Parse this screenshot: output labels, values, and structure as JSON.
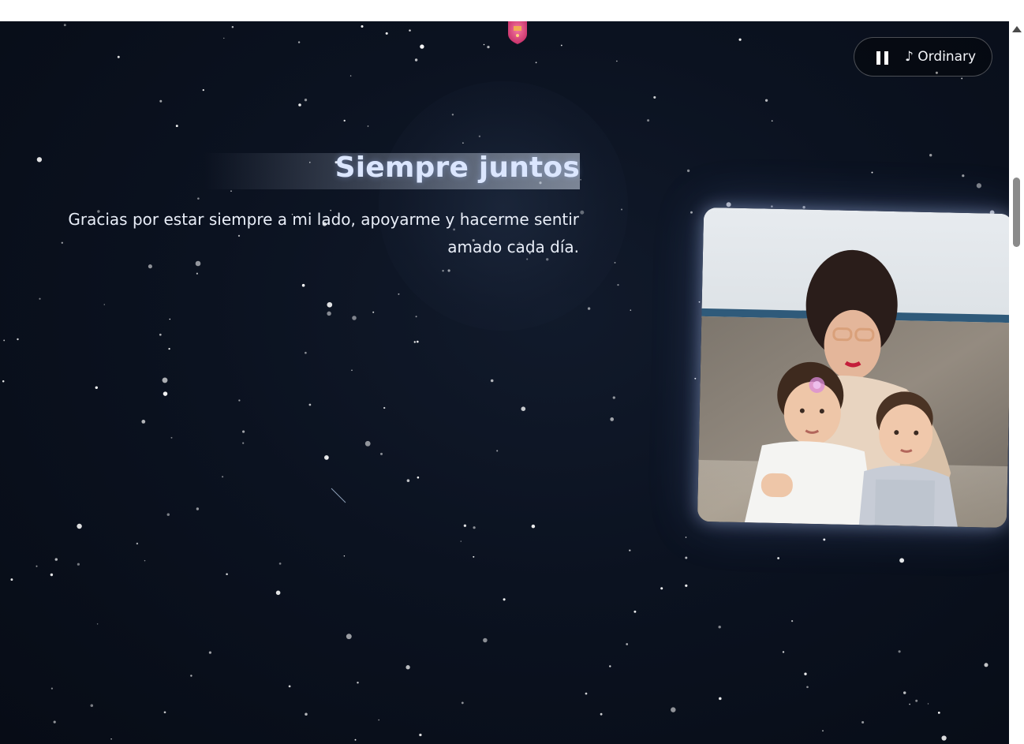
{
  "section": {
    "title": "Siempre juntos",
    "message_line1": "Gracias por estar siempre a mi lado, apoyarme y hacerme sentir",
    "message_line2": "amado cada día."
  },
  "music_player": {
    "state": "playing",
    "pause_icon": "pause-icon",
    "track_label": "♪ Ordinary"
  },
  "photo": {
    "description_icon": "family-photo"
  },
  "colors": {
    "background": "#0b1220",
    "title": "#dbe6ff",
    "text": "#e9eef8",
    "heart_accent": "#e0457b"
  }
}
